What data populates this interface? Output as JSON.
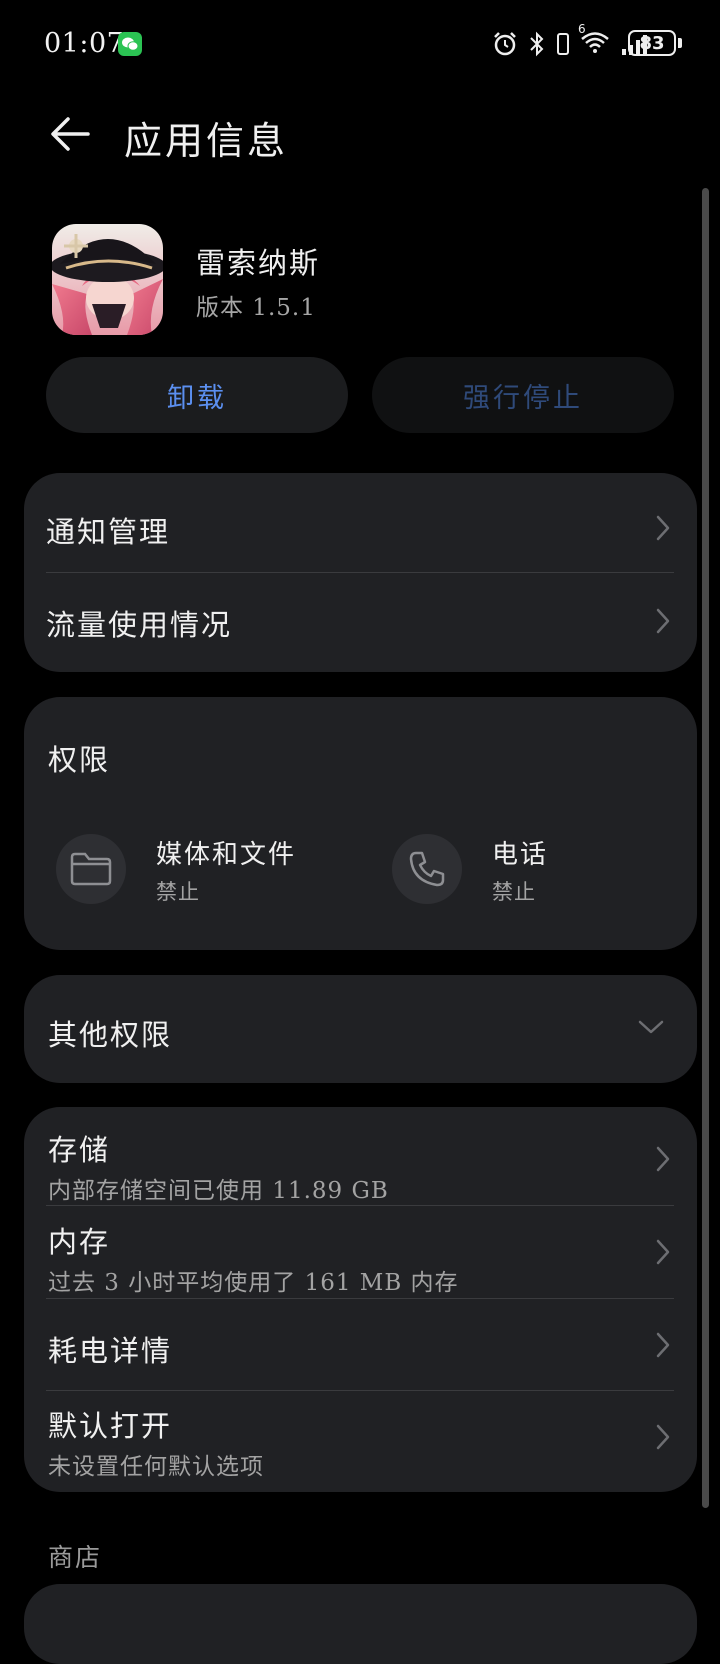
{
  "status_bar": {
    "time": "01:07",
    "battery": "83",
    "network_label": "6"
  },
  "header": {
    "title": "应用信息",
    "back_icon": "arrow-left-icon"
  },
  "app": {
    "name": "雷索纳斯",
    "version": "版本 1.5.1"
  },
  "actions": {
    "uninstall": "卸载",
    "force_stop": "强行停止"
  },
  "card1": {
    "items": [
      {
        "label": "通知管理"
      },
      {
        "label": "流量使用情况"
      }
    ]
  },
  "permissions": {
    "title": "权限",
    "items": [
      {
        "label": "媒体和文件",
        "status": "禁止",
        "icon": "folder-icon"
      },
      {
        "label": "电话",
        "status": "禁止",
        "icon": "phone-icon"
      }
    ]
  },
  "other_permissions": {
    "label": "其他权限"
  },
  "card3": {
    "items": [
      {
        "label": "存储",
        "sub": "内部存储空间已使用 11.89 GB"
      },
      {
        "label": "内存",
        "sub": "过去 3 小时平均使用了 161 MB 内存"
      },
      {
        "label": "耗电详情"
      },
      {
        "label": "默认打开",
        "sub": "未设置任何默认选项"
      }
    ]
  },
  "store": {
    "title": "商店"
  },
  "colors": {
    "background": "#000000",
    "card": "#202124",
    "accent": "#5b8ff0"
  }
}
